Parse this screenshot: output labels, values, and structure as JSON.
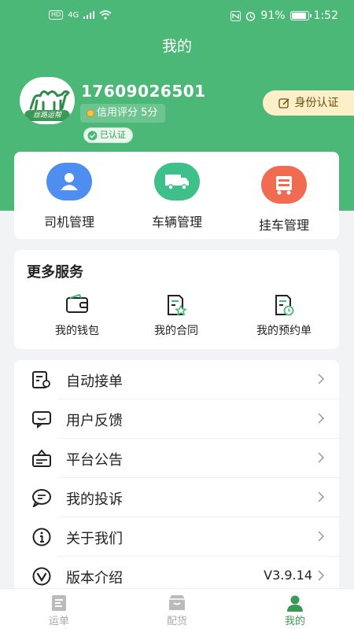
{
  "status_bar": {
    "network_badge": "HD",
    "network_type": "4G",
    "battery": "91%",
    "time": "1:52"
  },
  "header": {
    "title": "我的"
  },
  "profile": {
    "avatar_text": "丝路运帮",
    "phone": "17609026501",
    "credit": "信用评分 5分",
    "verified": "已认证",
    "id_auth_button": "身份认证"
  },
  "management": [
    {
      "label": "司机管理",
      "color": "#4e8ef0"
    },
    {
      "label": "车辆管理",
      "color": "#3fbf8a"
    },
    {
      "label": "挂车管理",
      "color": "#f06b4f"
    }
  ],
  "services": {
    "title": "更多服务",
    "items": [
      {
        "label": "我的钱包",
        "icon": "wallet-icon"
      },
      {
        "label": "我的合同",
        "icon": "contract-icon"
      },
      {
        "label": "我的预约单",
        "icon": "reservation-icon"
      }
    ]
  },
  "menu": [
    {
      "label": "自动接单",
      "icon": "auto-order-icon",
      "value": ""
    },
    {
      "label": "用户反馈",
      "icon": "feedback-icon",
      "value": ""
    },
    {
      "label": "平台公告",
      "icon": "announcement-icon",
      "value": ""
    },
    {
      "label": "我的投诉",
      "icon": "complaint-icon",
      "value": ""
    },
    {
      "label": "关于我们",
      "icon": "info-icon",
      "value": ""
    },
    {
      "label": "版本介绍",
      "icon": "version-icon",
      "value": "V3.9.14"
    }
  ],
  "bottom_nav": [
    {
      "label": "运单",
      "icon": "waybill-icon",
      "active": false
    },
    {
      "label": "配货",
      "icon": "cargo-icon",
      "active": false
    },
    {
      "label": "我的",
      "icon": "profile-icon",
      "active": true
    }
  ],
  "colors": {
    "primary_green": "#4cb877",
    "active_green": "#3a9a55"
  }
}
